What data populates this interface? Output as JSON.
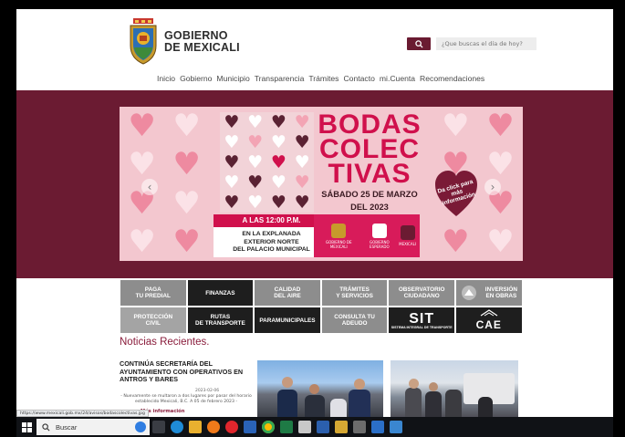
{
  "header": {
    "logo_line1": "GOBIERNO",
    "logo_line2": "DE MEXICALI",
    "search_placeholder": "¿Que buscas el día de hoy?"
  },
  "nav": [
    "Inicio",
    "Gobierno",
    "Municipio",
    "Transparencia",
    "Trámites",
    "Contacto",
    "mi.Cuenta",
    "Recomendaciones"
  ],
  "banner": {
    "title_line1": "BODAS",
    "title_line2": "COLEC",
    "title_line3": "TIVAS",
    "date_line1": "SÁBADO 25 DE MARZO",
    "date_line2": "DEL 2023",
    "time": "A LAS 12:00 P.M.",
    "place_line1": "EN LA EXPLANADA",
    "place_line2": "EXTERIOR NORTE",
    "place_line3": "DEL PALACIO MUNICIPAL",
    "cta": "Da click para más información",
    "sponsor1": "GOBIERNO DE MEXICALI",
    "sponsor2": "GOBIERNO ESPERADO",
    "sponsor3": "MEXICALI",
    "prev_arrow": "‹",
    "next_arrow": "›"
  },
  "tiles": [
    {
      "line1": "PAGA",
      "line2": "TU PREDIAL",
      "style": "g"
    },
    {
      "line1": "FINANZAS",
      "line2": "",
      "style": "d"
    },
    {
      "line1": "CALIDAD",
      "line2": "DEL AIRE",
      "style": "g"
    },
    {
      "line1": "TRÁMITES",
      "line2": "Y SERVICIOS",
      "style": "g"
    },
    {
      "line1": "OBSERVATORIO",
      "line2": "CIUDADANO",
      "style": "g"
    },
    {
      "line1": "INVERSIÓN",
      "line2": "EN OBRAS",
      "style": "g"
    },
    {
      "line1": "PROTECCIÓN",
      "line2": "CIVIL",
      "style": "g2"
    },
    {
      "line1": "RUTAS",
      "line2": "DE TRANSPORTE",
      "style": "d"
    },
    {
      "line1": "PARAMUNICIPALES",
      "line2": "",
      "style": "d"
    },
    {
      "line1": "CONSULTA TU ADEUDO",
      "line2": "",
      "style": "g"
    },
    {
      "line1": "SIT",
      "line2": "SISTEMA INTEGRAL DE TRANSPORTE",
      "style": "d"
    },
    {
      "line1": "CAE",
      "line2": "",
      "style": "d"
    }
  ],
  "news": {
    "heading": "Noticias Recientes.",
    "title": "CONTINÚA SECRETARÍA DEL AYUNTAMIENTO CON OPERATIVOS EN ANTROS Y BARES",
    "date": "2023-02-06",
    "excerpt": "- Nuevamente se multaron a dos lugares por pasar del horario establecido Mexicali, B.C. A 05 de febrero 2023 -",
    "more": "Más información"
  },
  "status_url": "https://www.mexicali.gob.mx/24/avisos/bodascolectivas.jpg",
  "taskbar": {
    "search_label": "Buscar"
  }
}
